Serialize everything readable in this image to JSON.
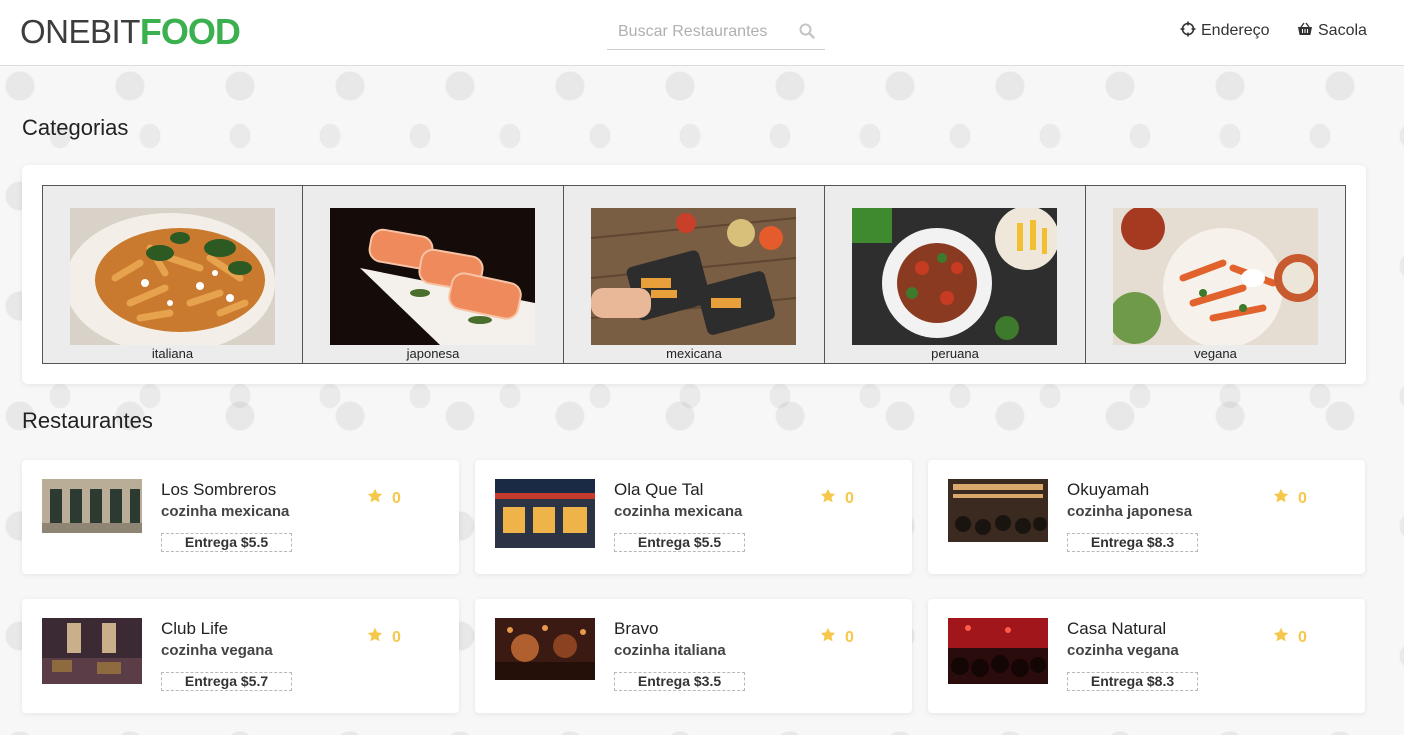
{
  "header": {
    "logo_thin": "ONEBIT",
    "logo_bold": "FOOD",
    "search_placeholder": "Buscar Restaurantes",
    "nav_address": "Endereço",
    "nav_bag": "Sacola"
  },
  "categories": {
    "title": "Categorias",
    "items": [
      {
        "label": "italiana"
      },
      {
        "label": "japonesa"
      },
      {
        "label": "mexicana"
      },
      {
        "label": "peruana"
      },
      {
        "label": "vegana"
      }
    ]
  },
  "restaurants": {
    "title": "Restaurantes",
    "items": [
      {
        "name": "Los Sombreros",
        "cuisine": "cozinha mexicana",
        "fee": "Entrega $5.5",
        "rating": "0"
      },
      {
        "name": "Ola Que Tal",
        "cuisine": "cozinha mexicana",
        "fee": "Entrega $5.5",
        "rating": "0"
      },
      {
        "name": "Okuyamah",
        "cuisine": "cozinha japonesa",
        "fee": "Entrega $8.3",
        "rating": "0"
      },
      {
        "name": "Club Life",
        "cuisine": "cozinha vegana",
        "fee": "Entrega $5.7",
        "rating": "0"
      },
      {
        "name": "Bravo",
        "cuisine": "cozinha italiana",
        "fee": "Entrega $3.5",
        "rating": "0"
      },
      {
        "name": "Casa Natural",
        "cuisine": "cozinha vegana",
        "fee": "Entrega $8.3",
        "rating": "0"
      }
    ]
  },
  "colors": {
    "brand_green": "#3ab04f",
    "star": "#f5c84c"
  }
}
